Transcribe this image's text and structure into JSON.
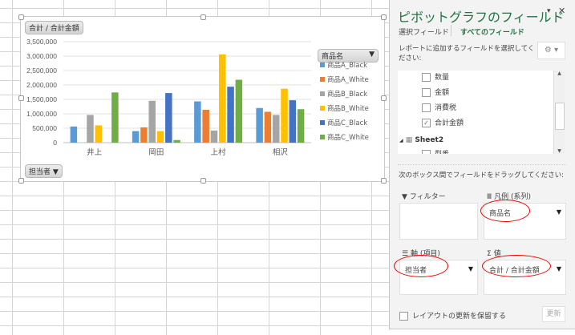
{
  "chart_data": {
    "type": "bar",
    "categories": [
      "井上",
      "岡田",
      "上村",
      "相沢"
    ],
    "ylim": [
      0,
      3500000
    ],
    "yticks": [
      "3,500,000",
      "3,000,000",
      "2,500,000",
      "2,000,000",
      "1,500,000",
      "1,000,000",
      "500,000",
      "0"
    ],
    "grid": true,
    "legend_position": "right",
    "series": [
      {
        "name": "商品A_Black",
        "color": "#5b9bd5",
        "values": [
          560000,
          400000,
          1430000,
          1200000
        ]
      },
      {
        "name": "商品A_White",
        "color": "#ed7d31",
        "values": [
          0,
          530000,
          1140000,
          1070000
        ]
      },
      {
        "name": "商品B_Black",
        "color": "#a5a5a5",
        "values": [
          960000,
          1450000,
          420000,
          960000
        ]
      },
      {
        "name": "商品B_White",
        "color": "#ffc000",
        "values": [
          600000,
          400000,
          3060000,
          1870000
        ]
      },
      {
        "name": "商品C_Black",
        "color": "#4472c4",
        "values": [
          0,
          1720000,
          1940000,
          1470000
        ]
      },
      {
        "name": "商品C_White",
        "color": "#70ad47",
        "values": [
          1740000,
          90000,
          2180000,
          1160000
        ]
      }
    ],
    "value_button": "合計 / 合計金額",
    "legend_button": "商品名",
    "axis_button": "担当者"
  },
  "pane": {
    "title": "ピボットグラフのフィールド",
    "tab_selected": "選択フィールド",
    "tab_all": "すべてのフィールド",
    "instruction": "レポートに追加するフィールドを選択してください:",
    "fields": [
      {
        "label": "数量",
        "checked": false
      },
      {
        "label": "金額",
        "checked": false
      },
      {
        "label": "消費税",
        "checked": false
      },
      {
        "label": "合計金額",
        "checked": true
      }
    ],
    "table_name": "Sheet2",
    "partial_field": "型番",
    "drag_instruction": "次のボックス間でフィールドをドラッグしてください:",
    "filter_label": "フィルター",
    "legend_label": "凡例 (系列)",
    "axis_label": "軸 (項目)",
    "values_label": "値",
    "legend_item": "商品名",
    "axis_item": "担当者",
    "values_item": "合計 / 合計金額",
    "defer_label": "レイアウトの更新を保留する",
    "update_button": "更新"
  }
}
